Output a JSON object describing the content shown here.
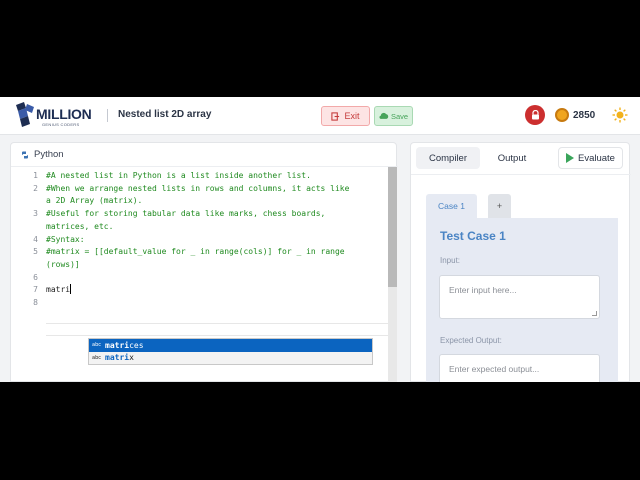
{
  "header": {
    "logo_text": "MILLION",
    "logo_subtext": "GENIUS CODERS",
    "title": "Nested list 2D array",
    "exit_label": "Exit",
    "save_label": "Save",
    "coins": "2850"
  },
  "editor": {
    "language": "Python",
    "lines": [
      {
        "num": "1",
        "text": "#A nested list in Python is a list inside another list."
      },
      {
        "num": "2",
        "text": "#When we arrange nested lists in rows and columns, it acts like"
      },
      {
        "num": "",
        "text": "a 2D Array (matrix)."
      },
      {
        "num": "3",
        "text": "#Useful for storing tabular data like marks, chess boards,"
      },
      {
        "num": "",
        "text": "matrices, etc."
      },
      {
        "num": "4",
        "text": "#Syntax:"
      },
      {
        "num": "5",
        "text": "#matrix = [[default_value for _ in range(cols)] for _ in range"
      },
      {
        "num": "",
        "text": "(rows)]"
      },
      {
        "num": "6",
        "text": ""
      },
      {
        "num": "7",
        "text": "matri"
      },
      {
        "num": "8",
        "text": ""
      }
    ],
    "suggestions": [
      {
        "kind": "abc",
        "match": "matri",
        "rest": "ces",
        "selected": true
      },
      {
        "kind": "abc",
        "match": "matri",
        "rest": "x",
        "selected": false
      }
    ]
  },
  "right": {
    "tab_compiler": "Compiler",
    "tab_output": "Output",
    "evaluate_label": "Evaluate",
    "case_tab": "Case 1",
    "add_tab": "+",
    "case_title": "Test Case 1",
    "input_label": "Input:",
    "input_placeholder": "Enter input here...",
    "expected_label": "Expected Output:",
    "expected_placeholder": "Enter expected output..."
  },
  "colors": {
    "accent_blue": "#4a84c4",
    "comment_green": "#1f8a1f",
    "exit_red": "#c53b3b",
    "save_green": "#46a45a"
  },
  "icons": {
    "logo": "million-logo-icon",
    "exit": "exit-icon",
    "save": "cloud-icon",
    "lock": "lock-icon",
    "coin": "coin-icon",
    "theme": "sun-icon",
    "language": "python-icon",
    "evaluate": "play-icon"
  }
}
